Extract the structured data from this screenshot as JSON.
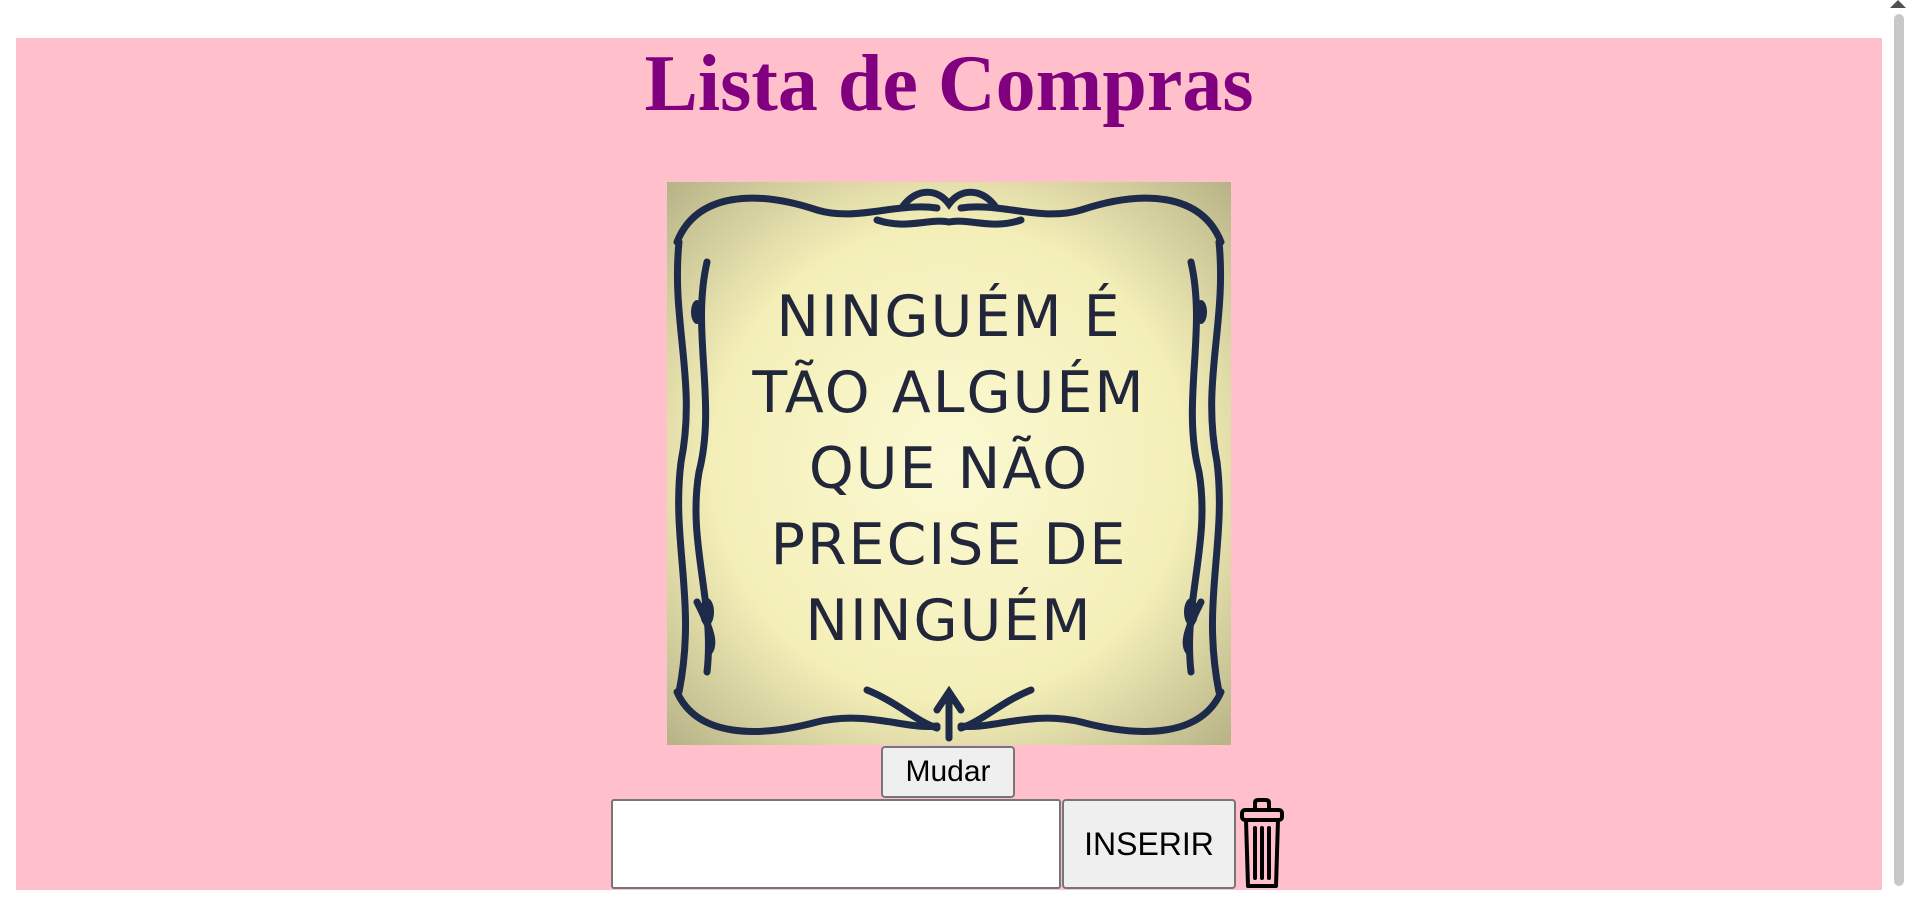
{
  "page": {
    "title": "Lista de Compras",
    "background_color": "#ffc0cb",
    "title_color": "#800080"
  },
  "image": {
    "lines": [
      "NINGUÉM É",
      "TÃO ALGUÉM",
      "QUE NÃO",
      "PRECISE DE",
      "NINGUÉM"
    ]
  },
  "controls": {
    "change_label": "Mudar",
    "item_value": "",
    "insert_label": "INSERIR",
    "delete_icon": "trash-icon"
  }
}
